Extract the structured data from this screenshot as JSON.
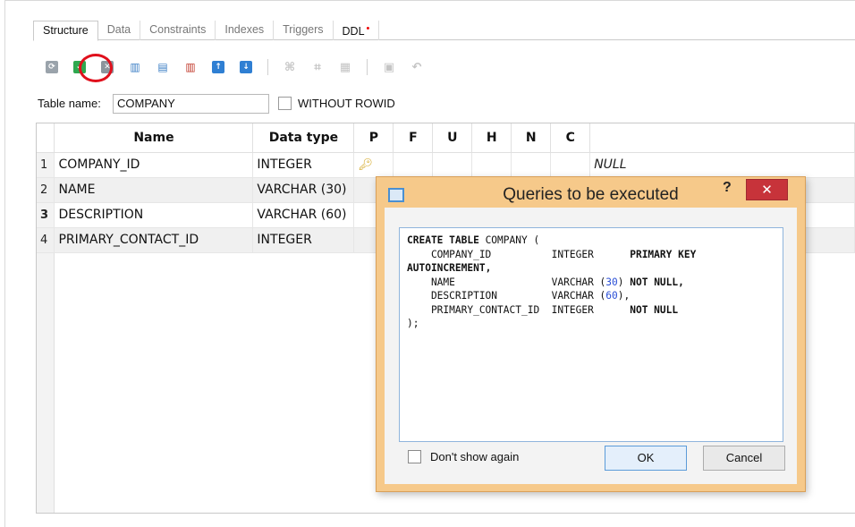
{
  "tabs": [
    {
      "label": "Structure",
      "active": true
    },
    {
      "label": "Data"
    },
    {
      "label": "Constraints"
    },
    {
      "label": "Indexes"
    },
    {
      "label": "Triggers"
    },
    {
      "label": "DDL",
      "modified_marker": "•"
    }
  ],
  "toolbar": {
    "icons": [
      "refresh-icon",
      "commit-icon",
      "rollback-icon",
      "add-column-icon",
      "insert-column-icon",
      "delete-column-icon",
      "move-up-icon",
      "move-down-icon",
      "add-primary-key-icon",
      "add-foreign-key-icon",
      "add-unique-icon",
      "add-check-icon",
      "undo-icon"
    ],
    "accent_ring_color": "#e0101c"
  },
  "table_name": {
    "label": "Table name:",
    "value": "COMPANY",
    "without_rowid_label": "WITHOUT ROWID",
    "without_rowid_checked": false
  },
  "grid": {
    "columns": [
      "Name",
      "Data type",
      "P",
      "F",
      "U",
      "H",
      "N",
      "C",
      ""
    ],
    "rows": [
      {
        "num": "1",
        "name": "COMPANY_ID",
        "type": "INTEGER",
        "pk": true,
        "default": "NULL"
      },
      {
        "num": "2",
        "name": "NAME",
        "type": "VARCHAR (30)"
      },
      {
        "num": "3",
        "name": "DESCRIPTION",
        "type": "VARCHAR (60)"
      },
      {
        "num": "4",
        "name": "PRIMARY_CONTACT_ID",
        "type": "INTEGER"
      }
    ]
  },
  "dialog": {
    "title": "Queries to be executed",
    "help": "?",
    "close": "✕",
    "sql": {
      "l1a": "CREATE TABLE",
      "l1b": " COMPANY (",
      "l2a": "    COMPANY_ID          INTEGER      ",
      "l2b": "PRIMARY KEY",
      "l3": "AUTOINCREMENT",
      "l3b": ",",
      "l4a": "    NAME                VARCHAR (",
      "l4n": "30",
      "l4b": ") ",
      "l4k": "NOT NULL",
      "l4c": ",",
      "l5a": "    DESCRIPTION         VARCHAR (",
      "l5n": "60",
      "l5b": "),",
      "l6a": "    PRIMARY_CONTACT_ID  INTEGER      ",
      "l6k": "NOT NULL",
      "l7": ");"
    },
    "dont_show_again_label": "Don't show again",
    "ok_label": "OK",
    "cancel_label": "Cancel"
  }
}
